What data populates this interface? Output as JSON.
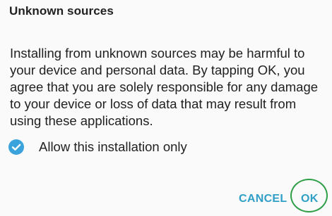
{
  "dialog": {
    "title": "Unknown sources",
    "message": "Installing from unknown sources may be harmful to your device and personal data. By tapping OK, you agree that you are solely responsible for any damage to your device or loss of data that may result from using these applications.",
    "checkbox": {
      "label": "Allow this installation only",
      "checked": true,
      "icon": "check-circle-icon"
    },
    "buttons": {
      "cancel": "CANCEL",
      "ok": "OK"
    }
  },
  "colors": {
    "accent": "#2f9fc7",
    "checkbox": "#3aa3dc",
    "highlight_ring": "#2e9e47",
    "background": "#fafafa",
    "text": "#212121"
  }
}
